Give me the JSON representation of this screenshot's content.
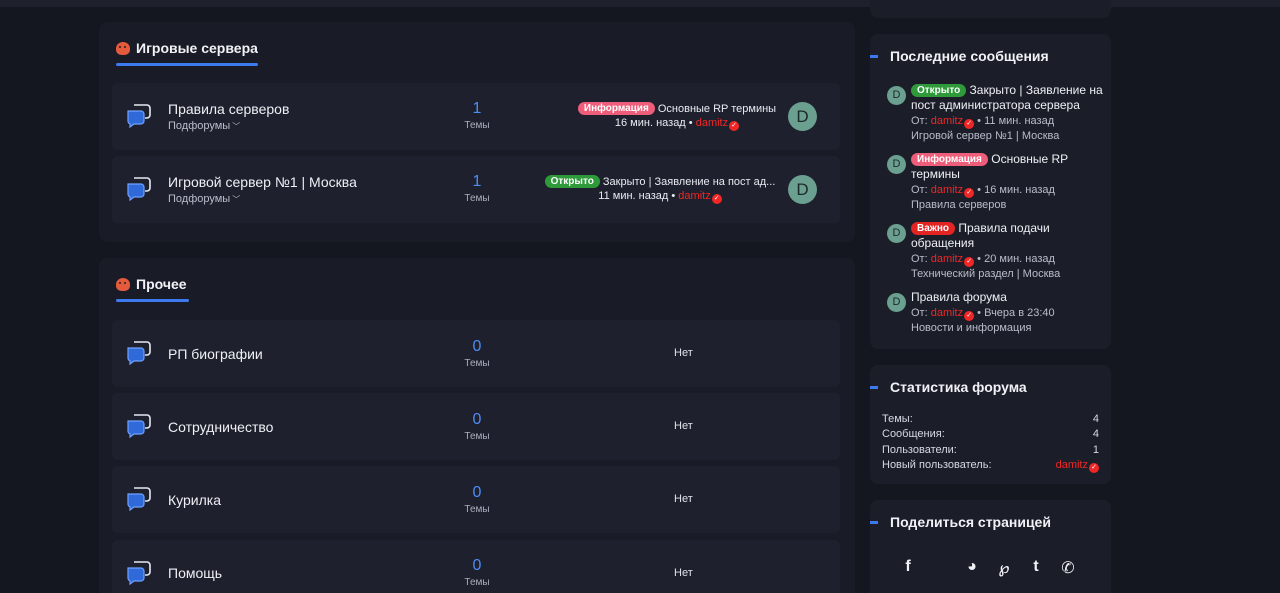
{
  "sections": [
    {
      "title": "Игровые сервера",
      "nodes": [
        {
          "name": "Правила серверов",
          "sub": "Подфорумы",
          "count": "1",
          "count_label": "Темы",
          "last_badge": "Информация",
          "last_title": "Основные RP термины",
          "last_time": "16 мин. назад",
          "last_user": "damitz",
          "avatar": "D"
        },
        {
          "name": "Игровой сервер №1 | Москва",
          "sub": "Подфорумы",
          "count": "1",
          "count_label": "Темы",
          "last_badge": "Открыто",
          "last_title": "Закрыто | Заявление на пост ад...",
          "last_time": "11 мин. назад",
          "last_user": "damitz",
          "avatar": "D"
        }
      ]
    },
    {
      "title": "Прочее",
      "nodes": [
        {
          "name": "РП биографии",
          "count": "0",
          "count_label": "Темы",
          "last": "Нет"
        },
        {
          "name": "Сотрудничество",
          "count": "0",
          "count_label": "Темы",
          "last": "Нет"
        },
        {
          "name": "Курилка",
          "count": "0",
          "count_label": "Темы",
          "last": "Нет"
        },
        {
          "name": "Помощь",
          "count": "0",
          "count_label": "Темы",
          "last": "Нет"
        }
      ]
    }
  ],
  "latest": {
    "title": "Последние сообщения",
    "items": [
      {
        "avatar": "D",
        "badge": "Открыто",
        "title": "Закрыто | Заявление на пост администратора сервера",
        "from": "От:",
        "user": "damitz",
        "time": "11 мин. назад",
        "forum": "Игровой сервер №1 | Москва"
      },
      {
        "avatar": "D",
        "badge": "Информация",
        "title": "Основные RP термины",
        "from": "От:",
        "user": "damitz",
        "time": "16 мин. назад",
        "forum": "Правила серверов"
      },
      {
        "avatar": "D",
        "badge": "Важно",
        "title": "Правила подачи обращения",
        "from": "От:",
        "user": "damitz",
        "time": "20 мин. назад",
        "forum": "Технический раздел | Москва"
      },
      {
        "avatar": "D",
        "badge": "",
        "title": "Правила форума",
        "from": "От:",
        "user": "damitz",
        "time": "Вчера в 23:40",
        "forum": "Новости и информация"
      }
    ]
  },
  "stats": {
    "title": "Статистика форума",
    "rows": [
      {
        "label": "Темы:",
        "value": "4"
      },
      {
        "label": "Сообщения:",
        "value": "4"
      },
      {
        "label": "Пользователи:",
        "value": "1"
      },
      {
        "label": "Новый пользователь:",
        "value": "damitz"
      }
    ]
  },
  "share": {
    "title": "Поделиться страницей",
    "icons": [
      "facebook-icon",
      "reddit-icon",
      "pinterest-icon",
      "tumblr-icon",
      "whatsapp-icon"
    ],
    "glyphs": [
      "f",
      "◕",
      "℘",
      "t",
      "✆"
    ]
  },
  "colors": {
    "accent": "#3d7af0",
    "username": "#f12626",
    "badge_info": "#ee5d79",
    "badge_open": "#2e9a3a",
    "badge_important": "#e42323"
  }
}
